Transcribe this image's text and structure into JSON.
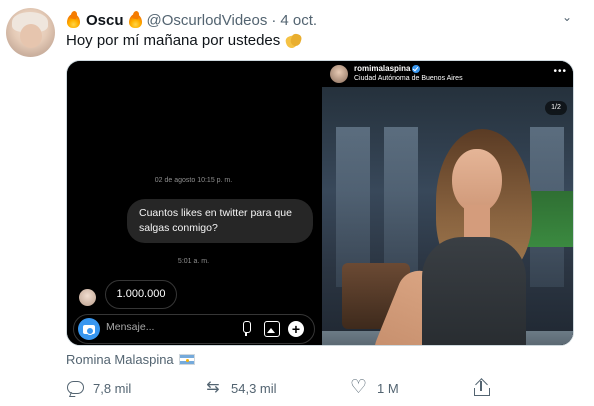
{
  "tweet": {
    "author_name": "Oscu",
    "author_handle": "@OscurlodVideos",
    "separator": "·",
    "date": "4 oct.",
    "text": "Hoy por mí mañana por ustedes",
    "emoji_after_text": "clapping-hands-icon"
  },
  "media": {
    "dm": {
      "date_stamp": "02 de agosto 10:15 p. m.",
      "incoming_message": "Cuantos likes en twitter para que salgas conmigo?",
      "time_stamp": "5:01 a. m.",
      "outgoing_message": "1.000.000",
      "input_placeholder": "Mensaje..."
    },
    "instagram": {
      "username": "romimalaspina",
      "location": "Ciudad Autónoma de Buenos Aires",
      "more_label": "•••",
      "counter": "1/2"
    }
  },
  "tagged": {
    "name": "Romina Malaspina"
  },
  "actions": {
    "replies": "7,8 mil",
    "retweets": "54,3 mil",
    "likes": "1 M",
    "retweet_glyph": "⇆",
    "caret_glyph": "⌄"
  },
  "colors": {
    "text_primary": "#0f1419",
    "text_secondary": "#536471",
    "instagram_blue": "#3897f0",
    "dm_bubble": "#262626"
  }
}
